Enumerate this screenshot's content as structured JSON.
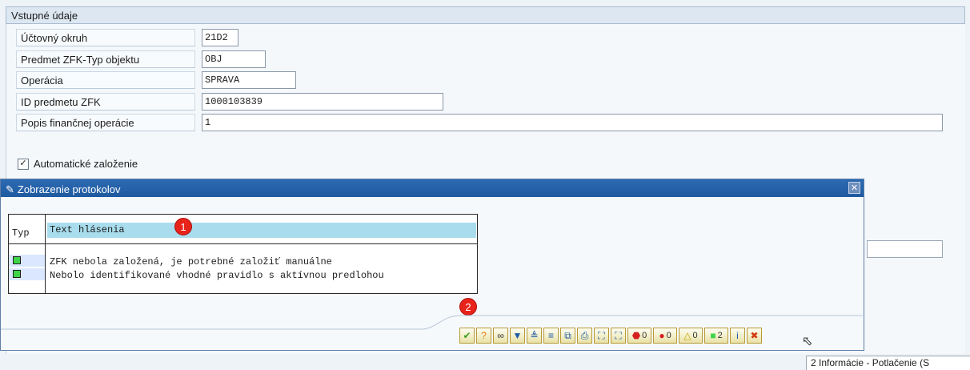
{
  "section": {
    "title": "Vstupné údaje"
  },
  "fields": [
    {
      "label": "Účtovný okruh",
      "value": "21D2"
    },
    {
      "label": "Predmet ZFK-Typ objektu",
      "value": "OBJ"
    },
    {
      "label": "Operácia",
      "value": "SPRAVA"
    },
    {
      "label": "ID predmetu ZFK",
      "value": "1000103839"
    },
    {
      "label": "Popis finančnej operácie",
      "value": "1"
    }
  ],
  "checkbox": {
    "label": "Automatické založenie",
    "checked": true,
    "mark": "✓"
  },
  "dialog": {
    "title": "Zobrazenie protokolov",
    "title_icon": "edit-document-icon",
    "close": "✕",
    "table": {
      "col_typ": "Typ",
      "col_text": "Text hlásenia",
      "rows": [
        {
          "type": "info-green-light",
          "text": "ZFK nebola založená, je potrebné založiť manuálne"
        },
        {
          "type": "info-green-light",
          "text": "Nebolo identifikované vhodné pravidlo s aktívnou predlohou"
        }
      ]
    },
    "callouts": [
      "1",
      "2"
    ],
    "toolbar": {
      "buttons": [
        {
          "icon": "check-icon",
          "glyph": "✔",
          "color": "#3a9e20"
        },
        {
          "icon": "help-icon",
          "glyph": "?",
          "color": "#e07a10"
        },
        {
          "icon": "glasses-icon",
          "glyph": "∞",
          "color": "#333"
        },
        {
          "icon": "filter-icon",
          "glyph": "▼",
          "color": "#1d5aa6"
        },
        {
          "icon": "sum-icon",
          "glyph": "≜",
          "color": "#1d5aa6"
        },
        {
          "icon": "sort-icon",
          "glyph": "≡",
          "color": "#1d5aa6"
        },
        {
          "icon": "layout-icon",
          "glyph": "⧉",
          "color": "#1d5aa6"
        },
        {
          "icon": "print-icon",
          "glyph": "⎙",
          "color": "#1d5aa6"
        },
        {
          "icon": "find-icon",
          "glyph": "⛶",
          "color": "#1d5aa6"
        },
        {
          "icon": "find-next-icon",
          "glyph": "⛶",
          "color": "#1d5aa6"
        }
      ],
      "counters": [
        {
          "icon": "stop-icon",
          "glyph": "⬣",
          "color": "#d62020",
          "count": "0"
        },
        {
          "icon": "error-icon",
          "glyph": "●",
          "color": "#d62020",
          "count": "0"
        },
        {
          "icon": "warning-icon",
          "glyph": "△",
          "color": "#c9a400",
          "count": "0"
        },
        {
          "icon": "info-green-icon",
          "glyph": "■",
          "color": "#3fd34a",
          "count": "2"
        }
      ],
      "tail": [
        {
          "icon": "information-icon",
          "glyph": "i",
          "color": "#1d5aa6"
        },
        {
          "icon": "cancel-icon",
          "glyph": "✖",
          "color": "#d23a10"
        }
      ]
    }
  },
  "status_bar": {
    "text": "2 Informácie  -  Potlačenie  (S"
  }
}
